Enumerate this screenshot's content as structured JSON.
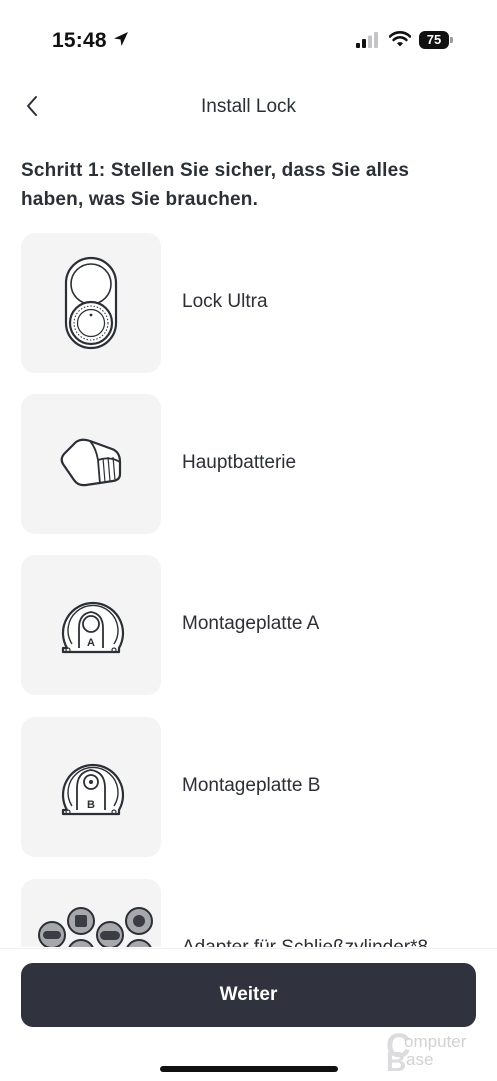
{
  "status_bar": {
    "time": "15:48",
    "battery": "75",
    "icons": [
      "location-arrow-icon",
      "cellular-signal-icon",
      "wifi-icon",
      "battery-icon"
    ]
  },
  "nav": {
    "title": "Install Lock",
    "back_icon": "chevron-left-icon"
  },
  "step": {
    "heading": "Schritt 1: Stellen Sie sicher, dass Sie alles haben, was Sie brauchen."
  },
  "items": [
    {
      "label": "Lock Ultra",
      "icon": "smart-lock-icon"
    },
    {
      "label": "Hauptbatterie",
      "icon": "battery-pack-icon"
    },
    {
      "label": "Montageplatte A",
      "icon": "mounting-plate-a-icon"
    },
    {
      "label": "Montageplatte B",
      "icon": "mounting-plate-b-icon"
    },
    {
      "label": "Adapter für Schließzylinder*8",
      "icon": "cylinder-adapters-icon"
    }
  ],
  "footer": {
    "next_label": "Weiter"
  },
  "watermark": {
    "line1": "omputer",
    "line2": "ase"
  },
  "colors": {
    "primary_button": "#30333d",
    "tile_background": "#f4f4f5",
    "text": "#2c2f36"
  }
}
